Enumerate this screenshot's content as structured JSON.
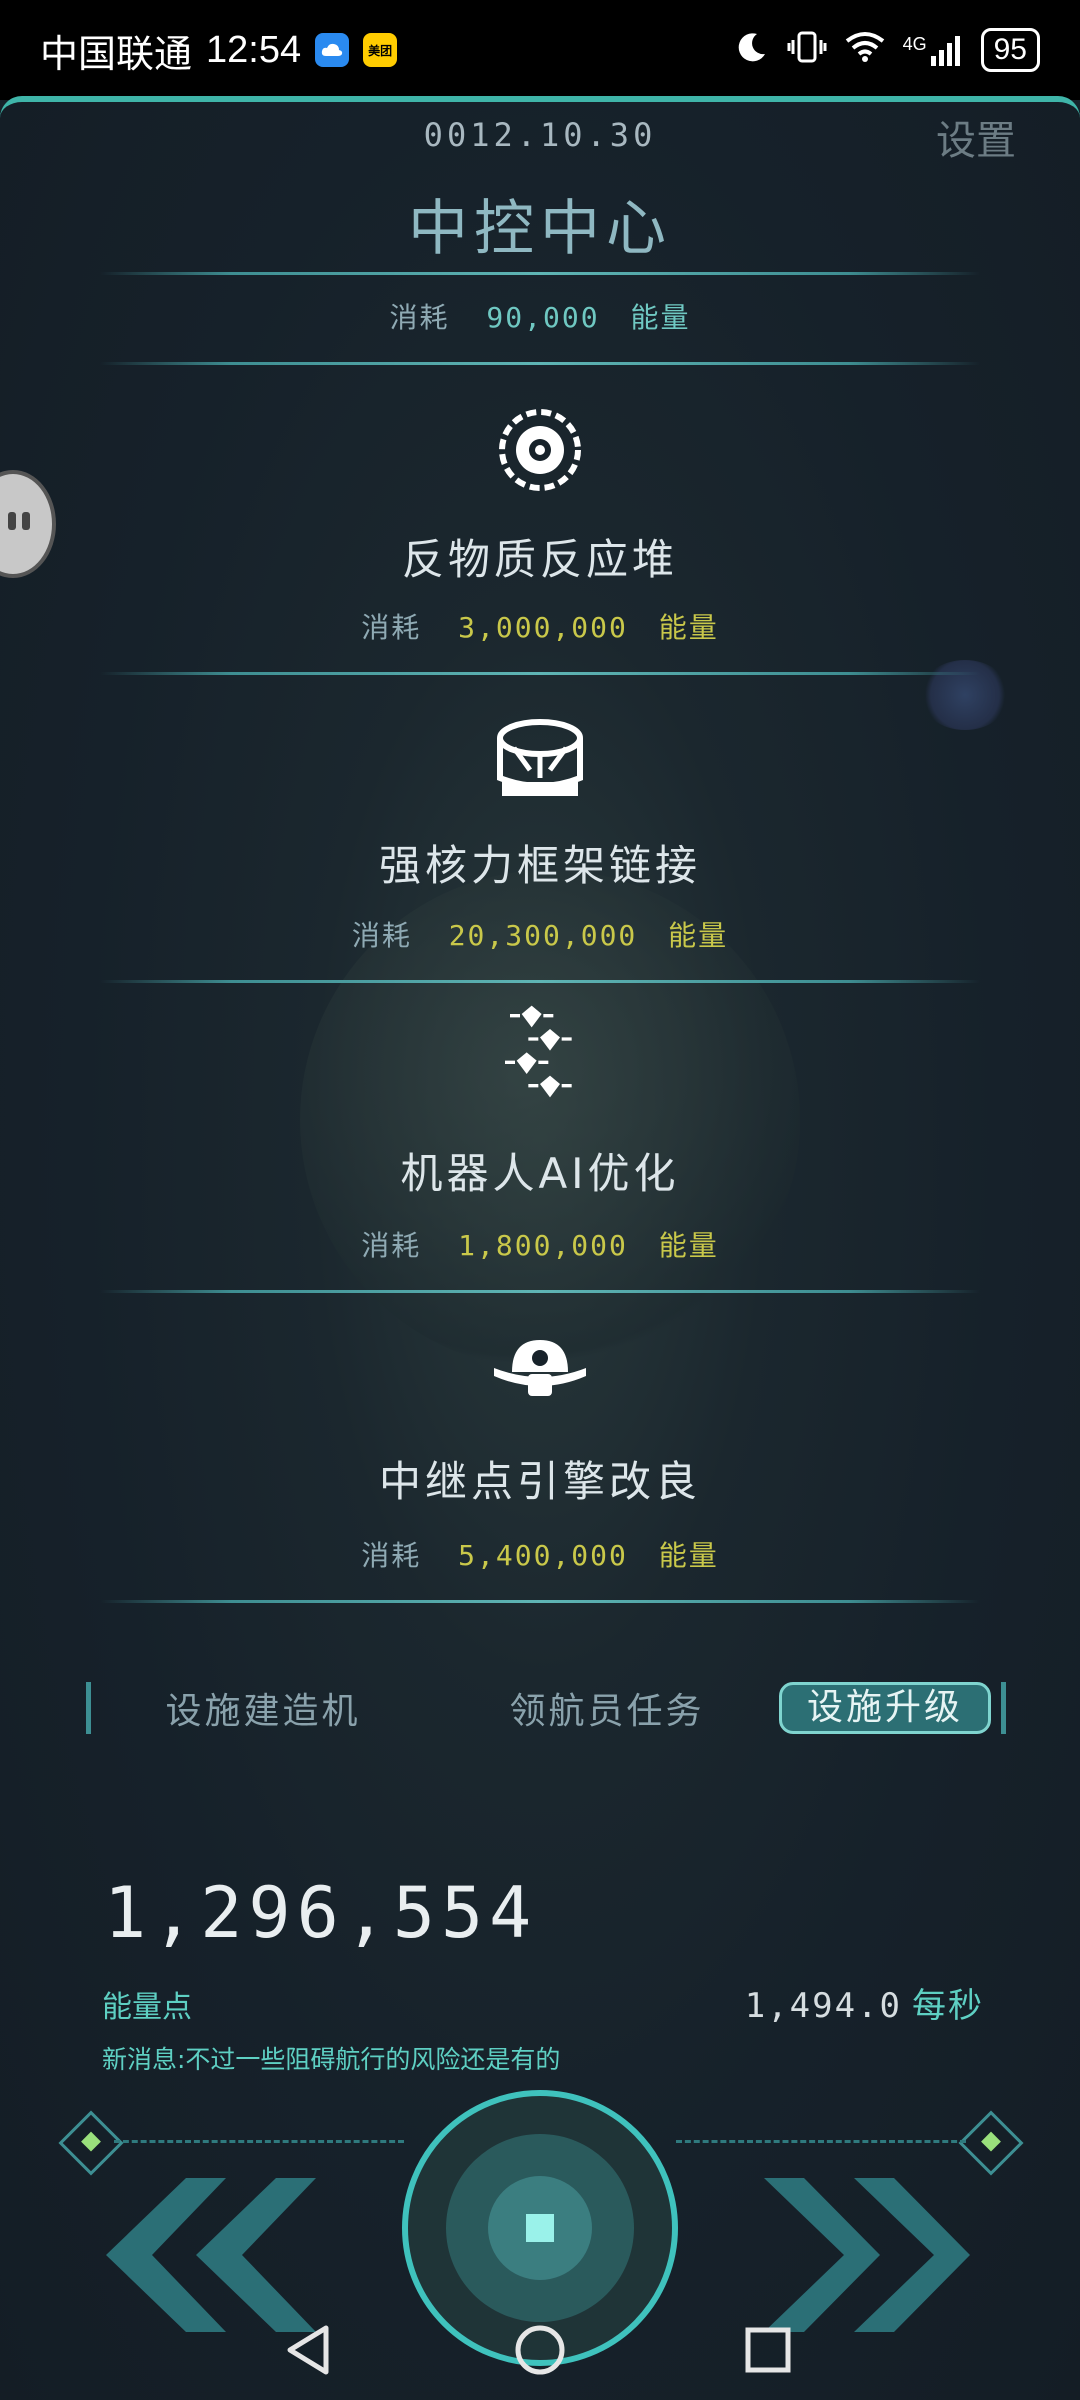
{
  "status_bar": {
    "carrier": "中国联通",
    "time": "12:54",
    "app_badge": "美团",
    "network": "4G",
    "battery": "95"
  },
  "header": {
    "date": "0012.10.30",
    "settings": "设置",
    "title": "中控中心"
  },
  "base_cost": {
    "label": "消耗",
    "value": "90,000",
    "unit": "能量"
  },
  "upgrades": [
    {
      "icon": "reactor-icon",
      "name": "反物质反应堆",
      "cost_label": "消耗",
      "cost": "3,000,000",
      "unit": "能量"
    },
    {
      "icon": "frame-icon",
      "name": "强核力框架链接",
      "cost_label": "消耗",
      "cost": "20,300,000",
      "unit": "能量"
    },
    {
      "icon": "robots-icon",
      "name": "机器人AI优化",
      "cost_label": "消耗",
      "cost": "1,800,000",
      "unit": "能量"
    },
    {
      "icon": "relay-engine-icon",
      "name": "中继点引擎改良",
      "cost_label": "消耗",
      "cost": "5,400,000",
      "unit": "能量"
    }
  ],
  "tabs": [
    {
      "label": "设施建造机",
      "active": false
    },
    {
      "label": "领航员任务",
      "active": false
    },
    {
      "label": "设施升级",
      "active": true
    }
  ],
  "resources": {
    "energy": "1,296,554",
    "energy_label": "能量点",
    "rate": "1,494.0",
    "rate_unit": "每秒",
    "message": "新消息:不过一些阻碍航行的风险还是有的"
  },
  "colors": {
    "accent": "#3fb5a9",
    "cost_value": "#c9c84a",
    "label_cyan": "#5ed0c3",
    "background": "#17222a"
  }
}
